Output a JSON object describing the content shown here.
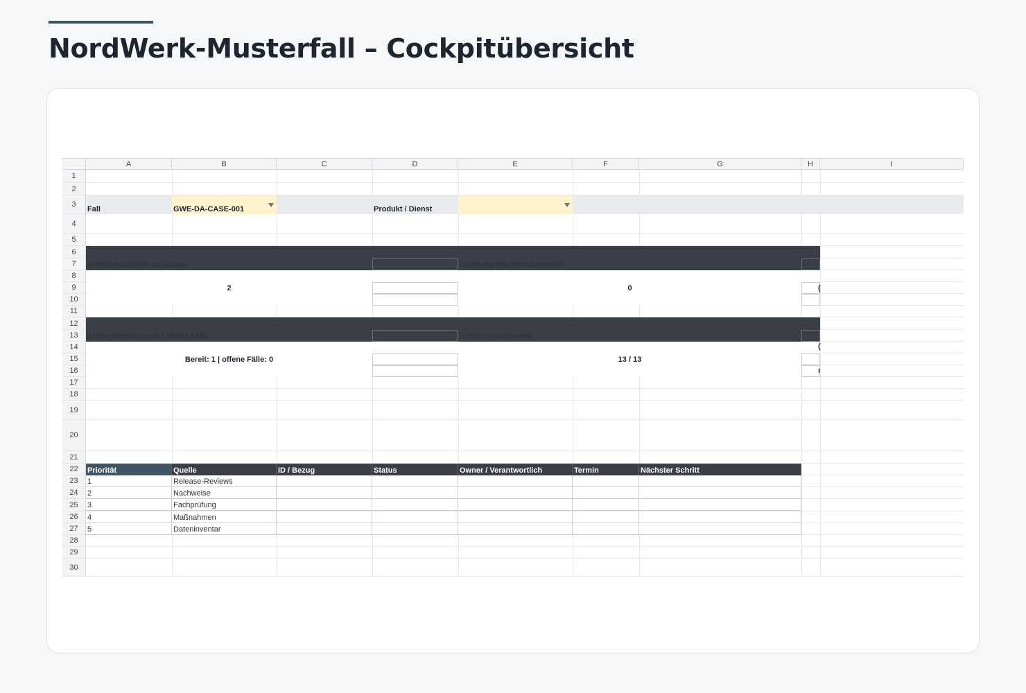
{
  "page": {
    "title": "NordWerk-Musterfall – Cockpitübersicht"
  },
  "sheet": {
    "columns": [
      "A",
      "B",
      "C",
      "D",
      "E",
      "F",
      "G",
      "H",
      "I"
    ],
    "rows": [
      "1",
      "2",
      "3",
      "4",
      "5",
      "6",
      "7",
      "8",
      "9",
      "10",
      "11",
      "12",
      "13",
      "14",
      "15",
      "16",
      "17",
      "18",
      "19",
      "20",
      "21",
      "22",
      "23",
      "24",
      "25",
      "26",
      "27",
      "28",
      "29",
      "30"
    ],
    "filters": {
      "case_label": "Fall",
      "case_value": "GWE-DA-CASE-001",
      "product_label": "Produkt / Dienst",
      "product_value": ""
    },
    "kpis": [
      {
        "title": "Produkte/Dienste im Scope",
        "value": "2"
      },
      {
        "title": "Datenobjekte mit Klärbedarf",
        "value": "0"
      },
      {
        "title": "Anfragebereitschaft / offene Fälle",
        "value": "Bereit: 1 | offene Fälle: 0"
      },
      {
        "title": "Kritische Nachweise",
        "value": "13 / 13"
      }
    ],
    "clipped": {
      "h9": "(",
      "h14": "(",
      "h16": "ı"
    },
    "table": {
      "headers": [
        "Priorität",
        "Quelle",
        "ID / Bezug",
        "Status",
        "Owner / Verantwortlich",
        "Termin",
        "Nächster Schritt"
      ],
      "rows": [
        [
          "1",
          "Release-Reviews",
          "",
          "",
          "",
          "",
          ""
        ],
        [
          "2",
          "Nachweise",
          "",
          "",
          "",
          "",
          ""
        ],
        [
          "3",
          "Fachprüfung",
          "",
          "",
          "",
          "",
          ""
        ],
        [
          "4",
          "Maßnahmen",
          "",
          "",
          "",
          "",
          ""
        ],
        [
          "5",
          "Dateninventar",
          "",
          "",
          "",
          "",
          ""
        ]
      ]
    }
  }
}
